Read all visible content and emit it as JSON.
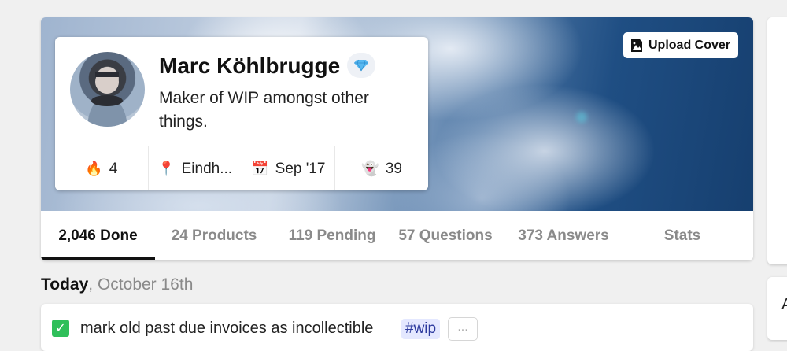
{
  "profile": {
    "name": "Marc Köhlbrugge",
    "badge_icon": "diamond-icon",
    "bio": "Maker of WIP amongst other things.",
    "upload_cover_label": "Upload Cover",
    "stats": [
      {
        "icon": "fire-icon",
        "glyph": "🔥",
        "value": "4"
      },
      {
        "icon": "pin-icon",
        "glyph": "📍",
        "value": "Eindh..."
      },
      {
        "icon": "calendar-icon",
        "glyph": "📅",
        "value": "Sep '17"
      },
      {
        "icon": "ghost-icon",
        "glyph": "👻",
        "value": "39"
      }
    ]
  },
  "tabs": [
    {
      "label": "2,046 Done",
      "active": true
    },
    {
      "label": "24 Products"
    },
    {
      "label": "119 Pending"
    },
    {
      "label": "57 Questions"
    },
    {
      "label": "373 Answers"
    },
    {
      "label": "Stats"
    }
  ],
  "feed": {
    "today_label": "Today",
    "date_suffix": ", October 16th",
    "task_text": "mark old past due invoices as incollectible",
    "task_hashtag": "#wip",
    "more_label": "..."
  },
  "right_panel": {
    "letter": "A"
  },
  "colors": {
    "accent": "#111111",
    "check": "#2fbf5a",
    "hashtag_bg": "#e4e8ff"
  }
}
